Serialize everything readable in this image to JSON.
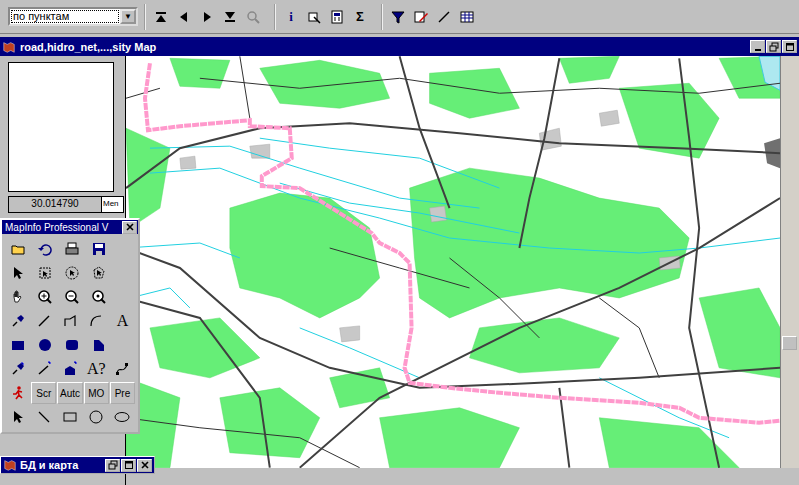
{
  "toolbar": {
    "dropdown": "по пунктам",
    "dropdown_arrow": "▼",
    "info_glyph": "i",
    "sum_glyph": "Σ"
  },
  "map_window": {
    "title": "road,hidro_net,...,sity Map"
  },
  "left_panel": {
    "coordinate": "30.014790",
    "tab": "Men"
  },
  "palette": {
    "title": "MapInfo Professional V",
    "text_tool": "A",
    "label_tool": "A?",
    "buttons": [
      "Scr",
      "Autc",
      "MO",
      "Pre"
    ]
  },
  "minimized_window": {
    "title": "БД и карта"
  }
}
